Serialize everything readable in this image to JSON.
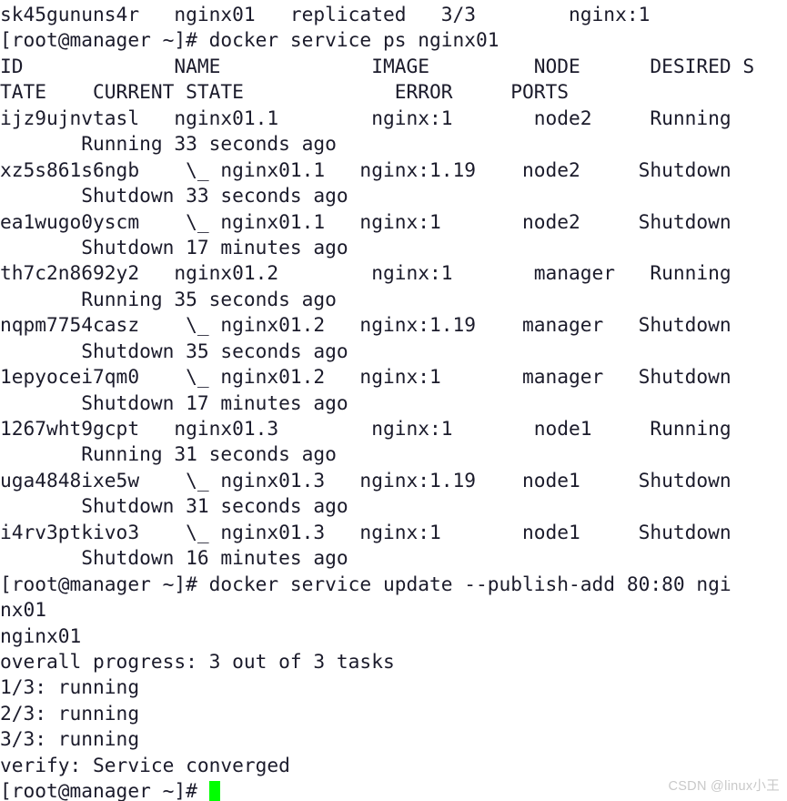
{
  "terminal": {
    "background_color": "#ffffff",
    "text_color": "#1b1b2b",
    "cursor_color": "#00ff00",
    "prompt": "[root@manager ~]#",
    "lines": [
      "sk45gununs4r   nginx01   replicated   3/3        nginx:1",
      "[root@manager ~]# docker service ps nginx01",
      "ID             NAME             IMAGE         NODE      DESIRED S",
      "TATE    CURRENT STATE             ERROR     PORTS",
      "ijz9ujnvtasl   nginx01.1        nginx:1       node2     Running",
      "       Running 33 seconds ago",
      "xz5s861s6ngb    \\_ nginx01.1   nginx:1.19    node2     Shutdown",
      "       Shutdown 33 seconds ago",
      "ea1wugo0yscm    \\_ nginx01.1   nginx:1       node2     Shutdown",
      "       Shutdown 17 minutes ago",
      "th7c2n8692y2   nginx01.2        nginx:1       manager   Running",
      "       Running 35 seconds ago",
      "nqpm7754casz    \\_ nginx01.2   nginx:1.19    manager   Shutdown",
      "       Shutdown 35 seconds ago",
      "1epyocei7qm0    \\_ nginx01.2   nginx:1       manager   Shutdown",
      "       Shutdown 17 minutes ago",
      "1267wht9gcpt   nginx01.3        nginx:1       node1     Running",
      "       Running 31 seconds ago",
      "uga4848ixe5w    \\_ nginx01.3   nginx:1.19    node1     Shutdown",
      "       Shutdown 31 seconds ago",
      "i4rv3ptkivo3    \\_ nginx01.3   nginx:1       node1     Shutdown",
      "       Shutdown 16 minutes ago",
      "[root@manager ~]# docker service update --publish-add 80:80 ngi",
      "nx01",
      "nginx01",
      "overall progress: 3 out of 3 tasks",
      "1/3: running",
      "2/3: running",
      "3/3: running",
      "verify: Service converged"
    ],
    "final_prompt_line": "[root@manager ~]# "
  },
  "watermark": {
    "text": "CSDN @linux小王",
    "color": "#c9c9c9"
  }
}
